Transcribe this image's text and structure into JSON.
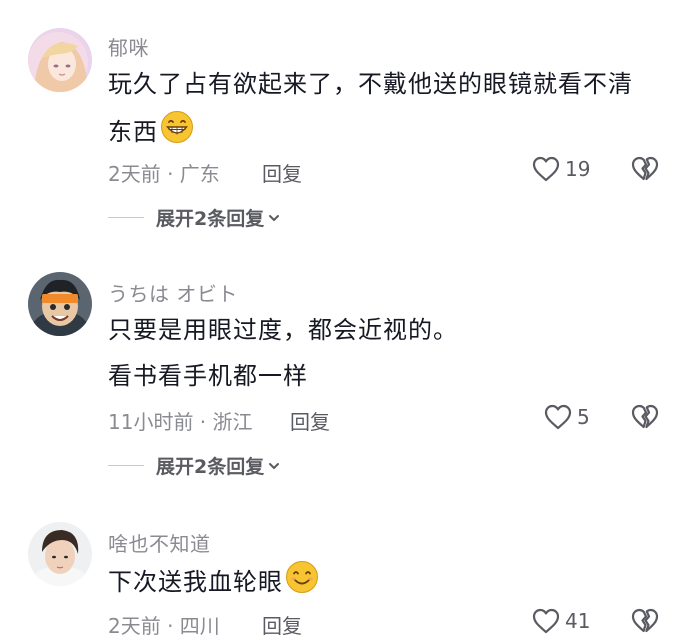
{
  "comments": [
    {
      "username": "郁咪",
      "lines": [
        "玩久了占有欲起来了，不戴他送的眼镜就看不清",
        "东西"
      ],
      "emoji": "grinning-face-emoji",
      "meta": "2天前 · 广东",
      "reply_label": "回复",
      "likes": "19",
      "expand_label": "展开2条回复"
    },
    {
      "username": "うちは オビト",
      "lines": [
        "只要是用眼过度，都会近视的。",
        "看书看手机都一样"
      ],
      "meta": "11小时前 · 浙江",
      "reply_label": "回复",
      "likes": "5",
      "expand_label": "展开2条回复"
    },
    {
      "username": "啥也不知道",
      "lines": [
        "下次送我血轮眼"
      ],
      "emoji": "smiling-face-emoji",
      "meta": "2天前 · 四川",
      "reply_label": "回复",
      "likes": "41"
    }
  ],
  "colors": {
    "text": "#161823",
    "secondary": "#8a8b91",
    "action": "#5a5b62",
    "emoji_yellow": "#f7c531"
  }
}
